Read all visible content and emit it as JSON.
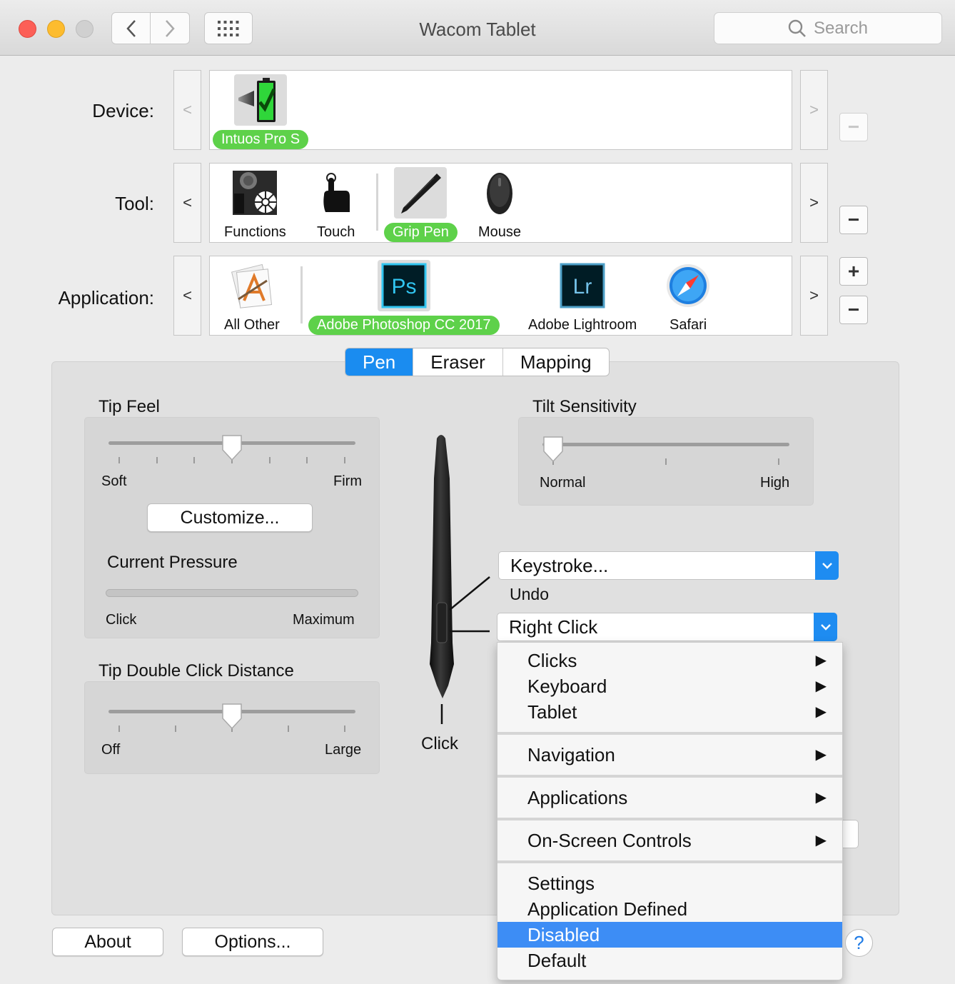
{
  "window": {
    "title": "Wacom Tablet"
  },
  "toolbar": {
    "search_placeholder": "Search"
  },
  "rows": {
    "device_label": "Device:",
    "tool_label": "Tool:",
    "application_label": "Application:",
    "nav_prev": "<",
    "nav_next": ">"
  },
  "devices": [
    {
      "label": "Intuos Pro S",
      "selected": true,
      "icon": "tablet-battery-icon"
    }
  ],
  "tools": [
    {
      "label": "Functions",
      "icon": "functions-icon"
    },
    {
      "label": "Touch",
      "icon": "touch-hand-icon"
    },
    {
      "label": "Grip Pen",
      "icon": "grip-pen-icon",
      "selected": true
    },
    {
      "label": "Mouse",
      "icon": "mouse-icon"
    }
  ],
  "applications": [
    {
      "label": "All Other",
      "icon": "all-other-apps-icon"
    },
    {
      "label": "Adobe Photoshop CC 2017",
      "icon": "photoshop-icon",
      "icon_text": "Ps",
      "selected": true
    },
    {
      "label": "Adobe Lightroom",
      "icon": "lightroom-icon",
      "icon_text": "Lr"
    },
    {
      "label": "Safari",
      "icon": "safari-icon"
    }
  ],
  "tabs": [
    {
      "label": "Pen",
      "active": true
    },
    {
      "label": "Eraser"
    },
    {
      "label": "Mapping"
    }
  ],
  "tip_feel": {
    "title": "Tip Feel",
    "min_label": "Soft",
    "max_label": "Firm",
    "value_fraction": 0.5,
    "customize_label": "Customize..."
  },
  "current_pressure": {
    "title": "Current Pressure",
    "min_label": "Click",
    "max_label": "Maximum",
    "value_fraction": 0
  },
  "tip_double_click": {
    "title": "Tip Double Click Distance",
    "min_label": "Off",
    "max_label": "Large",
    "value_fraction": 0.5
  },
  "tilt": {
    "title": "Tilt Sensitivity",
    "min_label": "Normal",
    "max_label": "High",
    "value_fraction": 0
  },
  "pen_buttons": {
    "upper_value": "Keystroke...",
    "upper_sub": "Undo",
    "lower_value": "Right Click",
    "tip_label": "Click"
  },
  "menu": {
    "groups": [
      [
        {
          "label": "Clicks",
          "submenu": true
        },
        {
          "label": "Keyboard",
          "submenu": true
        },
        {
          "label": "Tablet",
          "submenu": true
        }
      ],
      [
        {
          "label": "Navigation",
          "submenu": true
        }
      ],
      [
        {
          "label": "Applications",
          "submenu": true
        }
      ],
      [
        {
          "label": "On-Screen Controls",
          "submenu": true
        }
      ],
      [
        {
          "label": "Settings"
        },
        {
          "label": "Application Defined"
        },
        {
          "label": "Disabled",
          "highlighted": true
        },
        {
          "label": "Default"
        }
      ]
    ],
    "submenu_glyph": "▶"
  },
  "footer": {
    "about_label": "About",
    "options_label": "Options...",
    "help_label": "?"
  },
  "colors": {
    "selection_green": "#5ed14a",
    "accent_blue": "#1a8cf0",
    "menu_highlight": "#3d8df5"
  }
}
